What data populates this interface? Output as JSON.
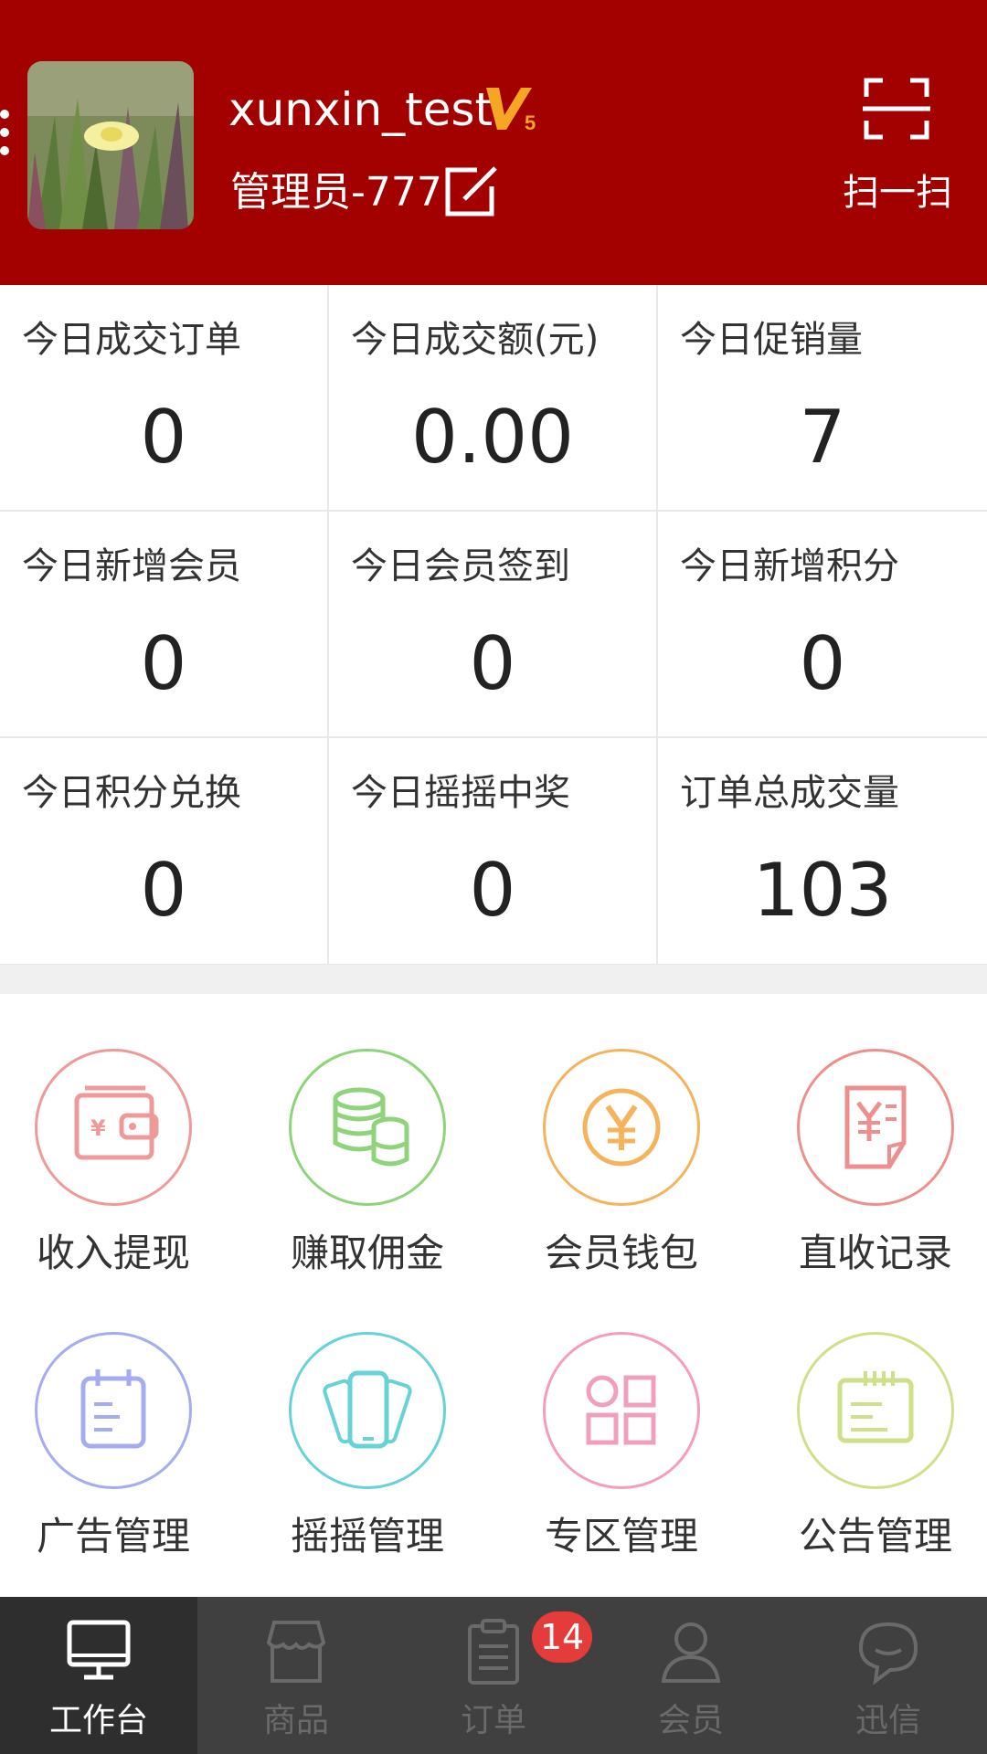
{
  "header": {
    "username": "xunxin_test",
    "vip_level": "V5",
    "role": "管理员-777",
    "scan_label": "扫一扫",
    "edit_icon": "edit-icon",
    "scan_icon": "scan-icon",
    "background_color": "#a30000"
  },
  "stats": [
    {
      "label": "今日成交订单",
      "value": "0"
    },
    {
      "label": "今日成交额(元)",
      "value": "0.00"
    },
    {
      "label": "今日促销量",
      "value": "7"
    },
    {
      "label": "今日新增会员",
      "value": "0"
    },
    {
      "label": "今日会员签到",
      "value": "0"
    },
    {
      "label": "今日新增积分",
      "value": "0"
    },
    {
      "label": "今日积分兑换",
      "value": "0"
    },
    {
      "label": "今日摇摇中奖",
      "value": "0"
    },
    {
      "label": "订单总成交量",
      "value": "103"
    }
  ],
  "functions": [
    {
      "label": "收入提现",
      "icon": "wallet-icon",
      "color": "#ee9a9a"
    },
    {
      "label": "赚取佣金",
      "icon": "coins-icon",
      "color": "#8fd47a"
    },
    {
      "label": "会员钱包",
      "icon": "yen-coin-icon",
      "color": "#f5b45c"
    },
    {
      "label": "直收记录",
      "icon": "receipt-icon",
      "color": "#ee8f8f"
    },
    {
      "label": "广告管理",
      "icon": "calendar-icon",
      "color": "#a6acf0"
    },
    {
      "label": "摇摇管理",
      "icon": "phone-shake-icon",
      "color": "#67d3d6"
    },
    {
      "label": "专区管理",
      "icon": "grid-icon",
      "color": "#f0a0be"
    },
    {
      "label": "公告管理",
      "icon": "notice-icon",
      "color": "#cfe08a"
    }
  ],
  "tabs": [
    {
      "label": "工作台",
      "icon": "monitor-icon",
      "active": true
    },
    {
      "label": "商品",
      "icon": "store-icon",
      "active": false
    },
    {
      "label": "订单",
      "icon": "clipboard-icon",
      "active": false,
      "badge": "14"
    },
    {
      "label": "会员",
      "icon": "user-icon",
      "active": false
    },
    {
      "label": "迅信",
      "icon": "chat-icon",
      "active": false
    }
  ]
}
